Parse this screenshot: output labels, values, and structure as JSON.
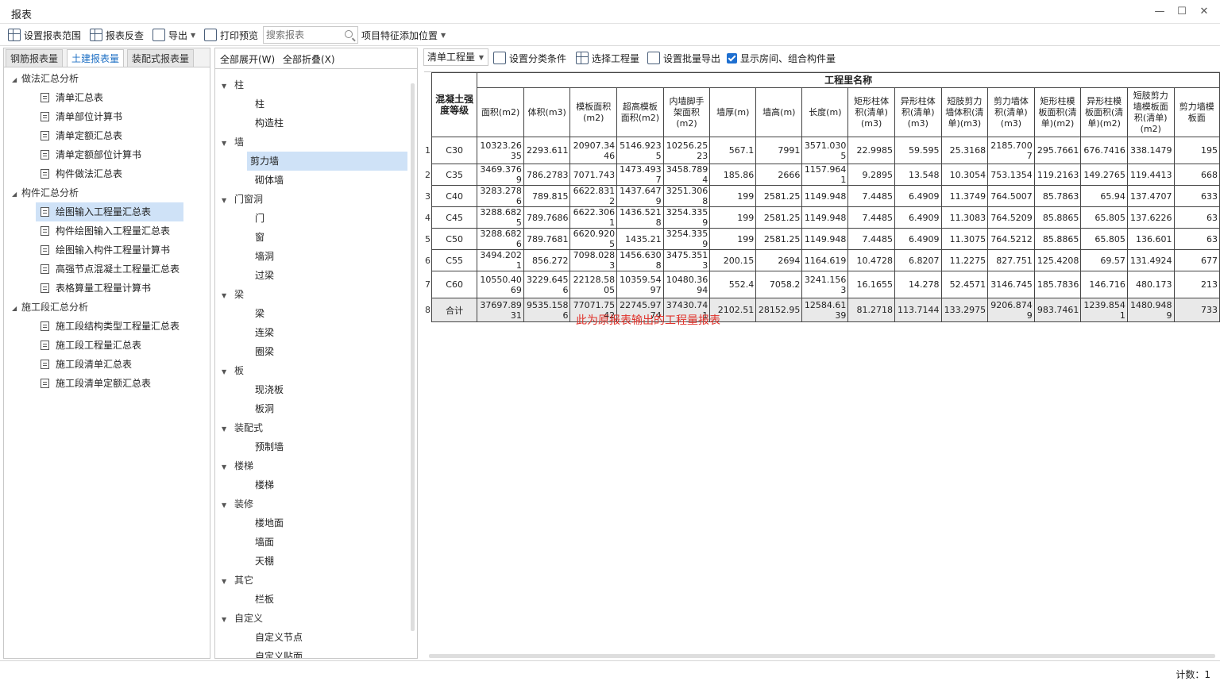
{
  "window": {
    "title": "报表",
    "controls": [
      "—",
      "☐",
      "✕"
    ]
  },
  "toolbar": {
    "set_range": "设置报表范围",
    "reverse_check": "报表反查",
    "export": "导出",
    "print_preview": "打印预览",
    "search_placeholder": "搜索报表",
    "feature_position": "项目特征添加位置"
  },
  "left": {
    "tabs": [
      "钢筋报表量",
      "土建报表量",
      "装配式报表量"
    ],
    "groups": [
      {
        "label": "做法汇总分析",
        "items": [
          "清单汇总表",
          "清单部位计算书",
          "清单定额汇总表",
          "清单定额部位计算书",
          "构件做法汇总表"
        ]
      },
      {
        "label": "构件汇总分析",
        "items": [
          "绘图输入工程量汇总表",
          "构件绘图输入工程量汇总表",
          "绘图输入构件工程量计算书",
          "高强节点混凝土工程量汇总表",
          "表格算量工程量计算书"
        ]
      },
      {
        "label": "施工段汇总分析",
        "items": [
          "施工段结构类型工程量汇总表",
          "施工段工程量汇总表",
          "施工段清单汇总表",
          "施工段清单定额汇总表"
        ]
      }
    ]
  },
  "middle": {
    "expand_all": "全部展开(W)",
    "collapse_all": "全部折叠(X)",
    "groups": [
      {
        "label": "柱",
        "items": [
          "柱",
          "构造柱"
        ]
      },
      {
        "label": "墙",
        "items": [
          "剪力墙",
          "砌体墙"
        ]
      },
      {
        "label": "门窗洞",
        "items": [
          "门",
          "窗",
          "墙洞",
          "过梁"
        ]
      },
      {
        "label": "梁",
        "items": [
          "梁",
          "连梁",
          "圈梁"
        ]
      },
      {
        "label": "板",
        "items": [
          "现浇板",
          "板洞"
        ]
      },
      {
        "label": "装配式",
        "items": [
          "预制墙"
        ]
      },
      {
        "label": "楼梯",
        "items": [
          "楼梯"
        ]
      },
      {
        "label": "装修",
        "items": [
          "楼地面",
          "墙面",
          "天棚"
        ]
      },
      {
        "label": "其它",
        "items": [
          "栏板"
        ]
      },
      {
        "label": "自定义",
        "items": [
          "自定义节点",
          "自定义贴面"
        ]
      }
    ]
  },
  "right": {
    "select_value": "清单工程量",
    "set_category": "设置分类条件",
    "select_quantity": "选择工程量",
    "batch_export": "设置批量导出",
    "show_rooms": "显示房间、组合构件量",
    "table": {
      "group_header": "工程里名称",
      "grade_header": "混凝土强度等级",
      "columns": [
        "面积(m2)",
        "体积(m3)",
        "模板面积(m2)",
        "超高模板面积(m2)",
        "内墙脚手架面积(m2)",
        "墙厚(m)",
        "墙高(m)",
        "长度(m)",
        "矩形柱体积(清单)(m3)",
        "异形柱体积(清单)(m3)",
        "短肢剪力墙体积(清单)(m3)",
        "剪力墙体积(清单)(m3)",
        "矩形柱模板面积(清单)(m2)",
        "异形柱模板面积(清单)(m2)",
        "短肢剪力墙模板面积(清单)(m2)",
        "剪力墙模板面"
      ],
      "rows": [
        {
          "n": "1",
          "grade": "C30",
          "vals": [
            "10323.2635",
            "2293.611",
            "20907.3446",
            "5146.9235",
            "10256.2523",
            "567.1",
            "7991",
            "3571.0305",
            "22.9985",
            "59.595",
            "25.3168",
            "2185.7007",
            "295.7661",
            "676.7416",
            "338.1479",
            "195"
          ]
        },
        {
          "n": "2",
          "grade": "C35",
          "vals": [
            "3469.3769",
            "786.2783",
            "7071.743",
            "1473.4937",
            "3458.7894",
            "185.86",
            "2666",
            "1157.9641",
            "9.2895",
            "13.548",
            "10.3054",
            "753.1354",
            "119.2163",
            "149.2765",
            "119.4413",
            "668"
          ]
        },
        {
          "n": "3",
          "grade": "C40",
          "vals": [
            "3283.2786",
            "789.815",
            "6622.8312",
            "1437.6479",
            "3251.3068",
            "199",
            "2581.25",
            "1149.948",
            "7.4485",
            "6.4909",
            "11.3749",
            "764.5007",
            "85.7863",
            "65.94",
            "137.4707",
            "633"
          ]
        },
        {
          "n": "4",
          "grade": "C45",
          "vals": [
            "3288.6825",
            "789.7686",
            "6622.3061",
            "1436.5218",
            "3254.3359",
            "199",
            "2581.25",
            "1149.948",
            "7.4485",
            "6.4909",
            "11.3083",
            "764.5209",
            "85.8865",
            "65.805",
            "137.6226",
            "63"
          ]
        },
        {
          "n": "5",
          "grade": "C50",
          "vals": [
            "3288.6826",
            "789.7681",
            "6620.9205",
            "1435.21",
            "3254.3359",
            "199",
            "2581.25",
            "1149.948",
            "7.4485",
            "6.4909",
            "11.3075",
            "764.5212",
            "85.8865",
            "65.805",
            "136.601",
            "63"
          ]
        },
        {
          "n": "6",
          "grade": "C55",
          "vals": [
            "3494.2021",
            "856.272",
            "7098.0283",
            "1456.6308",
            "3475.3513",
            "200.15",
            "2694",
            "1164.619",
            "10.4728",
            "6.8207",
            "11.2275",
            "827.751",
            "125.4208",
            "69.57",
            "131.4924",
            "677"
          ]
        },
        {
          "n": "7",
          "grade": "C60",
          "vals": [
            "10550.4069",
            "3229.6456",
            "22128.5805",
            "10359.5497",
            "10480.3694",
            "552.4",
            "7058.2",
            "3241.1563",
            "16.1655",
            "14.278",
            "52.4571",
            "3146.745",
            "185.7836",
            "146.716",
            "480.173",
            "213"
          ]
        },
        {
          "n": "8",
          "grade": "合计",
          "vals": [
            "37697.8931",
            "9535.1586",
            "77071.7542",
            "22745.9774",
            "37430.741",
            "2102.51",
            "28152.95",
            "12584.6139",
            "81.2718",
            "113.7144",
            "133.2975",
            "9206.8749",
            "983.7461",
            "1239.8541",
            "1480.9489",
            "733"
          ]
        }
      ]
    },
    "note": "此为原报表输出的工程量报表"
  },
  "status": {
    "count": "计数：1"
  }
}
